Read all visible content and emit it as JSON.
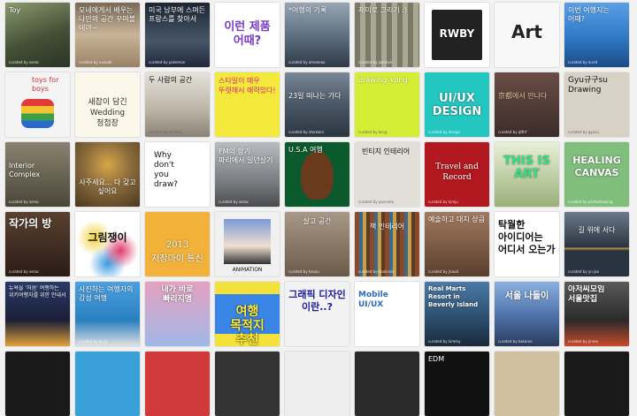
{
  "tiles": [
    {
      "title": "Toy",
      "footer": "curated by xerox",
      "bg": "#3b4a3a"
    },
    {
      "title": "모네에게서 배우는 나만의 공간 꾸며볼 테야~",
      "footer": "curated by nusoah",
      "bg": "#b8a282"
    },
    {
      "title": "미국 남부에 스며든 프랑스를 찾아서",
      "footer": "curated by pokemon",
      "bg": "#2a3542"
    },
    {
      "title": "이런 제품 어때?",
      "footer": "",
      "bg": "#ffffff"
    },
    {
      "title": "*여행의 기록",
      "footer": "curated by ameeeaa",
      "bg": "#6e7f90"
    },
    {
      "title": "재미로 그리기 :)",
      "footer": "curated by jasneve",
      "bg": "#8c8c7a"
    },
    {
      "title": "RWBY",
      "footer": "",
      "bg": "#ffffff"
    },
    {
      "title": "Art",
      "footer": "",
      "bg": "#f8f8f8"
    },
    {
      "title": "이번 여행지는 어때?",
      "footer": "curated by eurid",
      "bg": "#2f78c4"
    },
    {
      "title": "toys for boys",
      "footer": "curated by xerox",
      "bg": "#f4f4f4"
    },
    {
      "title": "새찹이 담긴 Wedding 청첩장",
      "footer": "",
      "bg": "#fbf7ea"
    },
    {
      "title": "두 사람의 공간",
      "footer": "curated by wintery",
      "bg": "#c8c2b8"
    },
    {
      "title": "스타일이 매우 뚜렷해서 매력있다!",
      "footer": "",
      "bg": "#f2e93a"
    },
    {
      "title": "23일 떠나는 가다",
      "footer": "curated by starwars",
      "bg": "#5d6b7a"
    },
    {
      "title": "drawing_kong",
      "footer": "curated by kong",
      "bg": "#d4ee35"
    },
    {
      "title": "UI/UX DESIGN",
      "footer": "curated by design",
      "bg": "#23c7c0"
    },
    {
      "title": "京都에서 만나다",
      "footer": "curated by qfthf",
      "bg": "#4a3c3a"
    },
    {
      "title": "Gyu규구su Drawing",
      "footer": "curated by gyusu",
      "bg": "#d8d2c6"
    },
    {
      "title": "Interior Complex",
      "footer": "curated by xerox",
      "bg": "#5f5a4e"
    },
    {
      "title": "사주세요... 다 갖고 싶어요",
      "footer": "",
      "bg": "#8a6b3c"
    },
    {
      "title": "Why don't you draw?",
      "footer": "",
      "bg": "#ffffff"
    },
    {
      "title": "FM의 향기 파리에서 일년살기",
      "footer": "curated by xerox",
      "bg": "#8d8f90"
    },
    {
      "title": "U.S.A 여행",
      "footer": "",
      "bg": "#0b5a2e"
    },
    {
      "title": "빈티지 인테리어",
      "footer": "curated by poncedu",
      "bg": "#e2dfd8"
    },
    {
      "title": "Travel and Record",
      "footer": "curated by kimju",
      "bg": "#b1181f"
    },
    {
      "title": "THIS IS ART",
      "footer": "",
      "bg": "#cfd9c0"
    },
    {
      "title": "HEALING CANVAS",
      "footer": "curated by pentadrawing",
      "bg": "#7fbf7b"
    },
    {
      "title": "작가의 방",
      "footer": "curated by xerox",
      "bg": "#3a2a22"
    },
    {
      "title": "그림쟁이",
      "footer": "",
      "bg": "#ffffff"
    },
    {
      "title": "2013 저장마이 통신",
      "footer": "",
      "bg": "#f2b23a"
    },
    {
      "title": "ANIMATION",
      "footer": "",
      "bg": "#f0f0f0"
    },
    {
      "title": "살고 공간",
      "footer": "curated by kanzu",
      "bg": "#8a7868"
    },
    {
      "title": "책 인테리어",
      "footer": "curated by booksvia",
      "bg": "#5c3a28"
    },
    {
      "title": "예술하고 대치 상큼",
      "footer": "curated by jnaud",
      "bg": "#7c5a46"
    },
    {
      "title": "탁월한 아이디어는 어디서 오는가",
      "footer": "",
      "bg": "#ffffff"
    },
    {
      "title": "길 위에 서다",
      "footer": "curated by yn jae",
      "bg": "#3a4652"
    },
    {
      "title": "뉴욕을 '처음' 여행하는 위키여행자를 위한 안내서",
      "footer": "",
      "bg": "#1a1f36"
    },
    {
      "title": "사진하는 여행자의 감성 여행",
      "footer": "curated by jk_pj",
      "bg": "#2a7fbf"
    },
    {
      "title": "내가 바로 빠리지앵",
      "footer": "",
      "bg": "#c5d0e6"
    },
    {
      "title": "여행 목적지 추천",
      "footer": "",
      "bg": "#f3e23a"
    },
    {
      "title": "그래픽 디자인 이란..?",
      "footer": "",
      "bg": "#f2f2f2"
    },
    {
      "title": "Mobile UI/UX",
      "footer": "",
      "bg": "#ffffff"
    },
    {
      "title": "Real Marts Resort in Beverly Island",
      "footer": "curated by kimmy",
      "bg": "#2b4b6a"
    },
    {
      "title": "서울 나들이",
      "footer": "curated by kakaroo",
      "bg": "#4c6fa8"
    },
    {
      "title": "아저씨모임 서울맛집",
      "footer": "curated by jinmo",
      "bg": "#3a3a3a"
    },
    {
      "title": "",
      "footer": "",
      "bg": "#1a1a1a"
    },
    {
      "title": "",
      "footer": "",
      "bg": "#3aa0d8"
    },
    {
      "title": "",
      "footer": "",
      "bg": "#d03a3a"
    },
    {
      "title": "",
      "footer": "",
      "bg": "#333333"
    },
    {
      "title": "",
      "footer": "",
      "bg": "#eeeeee"
    },
    {
      "title": "",
      "footer": "",
      "bg": "#2a2a2a"
    },
    {
      "title": "EDM",
      "footer": "",
      "bg": "#111111"
    },
    {
      "title": "",
      "footer": "",
      "bg": "#d0c0a0"
    },
    {
      "title": "",
      "footer": "",
      "bg": "#1a1a1a"
    }
  ]
}
